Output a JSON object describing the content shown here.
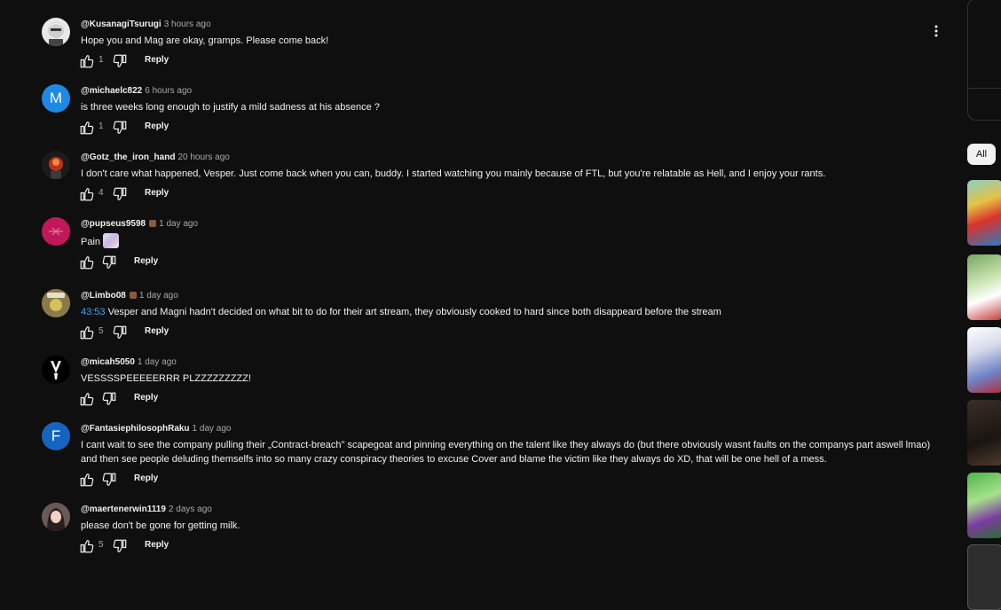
{
  "comments": [
    {
      "author": "@KusanagiTsurugi",
      "time": "3 hours ago",
      "text": "Hope you and Mag are okay, gramps. Please come back!",
      "likes": "1",
      "reply": "Reply",
      "avatar_letter": "",
      "avatar_color": "#e8e8e8"
    },
    {
      "author": "@michaelc822",
      "time": "6 hours ago",
      "text": "is three weeks long enough to justify a mild sadness at his absence ?",
      "likes": "1",
      "reply": "Reply",
      "avatar_letter": "M",
      "avatar_color": "#1e88e5"
    },
    {
      "author": "@Gotz_the_iron_hand",
      "time": "20 hours ago",
      "text": "I don't care what happened, Vesper. Just come back when you can, buddy. I started watching you mainly because of FTL, but you're relatable as Hell, and I enjoy your rants.",
      "likes": "4",
      "reply": "Reply",
      "avatar_letter": "",
      "avatar_color": "#1b1b1b"
    },
    {
      "author": "@pupseus9598",
      "time": "1 day ago",
      "text": "Pain",
      "likes": "",
      "reply": "Reply",
      "avatar_letter": "",
      "avatar_color": "#c2185b"
    },
    {
      "author": "@Limbo08",
      "time": "1 day ago",
      "timestamp_link": "43:53",
      "text": " Vesper and Magni hadn't decided on what bit to do for their art stream, they obviously cooked to hard since both disappeard before the stream",
      "likes": "5",
      "reply": "Reply",
      "avatar_letter": "",
      "avatar_color": "#6d5a2a"
    },
    {
      "author": "@micah5050",
      "time": "1 day ago",
      "text": "VESSSSPEEEEERRR PLZZZZZZZZZ!",
      "likes": "",
      "reply": "Reply",
      "avatar_letter": "",
      "avatar_color": "#000000"
    },
    {
      "author": "@FantasiephilosophRaku",
      "time": "1 day ago",
      "text": "I cant wait to see the company pulling their „Contract-breach\" scapegoat and pinning everything on the talent like they always do (but there obviously wasnt faults on the companys part aswell lmao) and then see people deluding themselfs into so many crazy conspiracy theories to excuse Cover and blame the victim like they always do XD, that will be one hell of a mess.",
      "likes": "",
      "reply": "Reply",
      "avatar_letter": "F",
      "avatar_color": "#1565c0"
    },
    {
      "author": "@maertenerwin1119",
      "time": "2 days ago",
      "text": "please don't be gone for getting milk.",
      "likes": "5",
      "reply": "Reply",
      "avatar_letter": "",
      "avatar_color": "#4a3a3a"
    }
  ],
  "chips": {
    "all": "All"
  },
  "icons": {
    "like": "thumbs-up-icon",
    "dislike": "thumbs-down-icon",
    "more": "more-vert-icon"
  }
}
